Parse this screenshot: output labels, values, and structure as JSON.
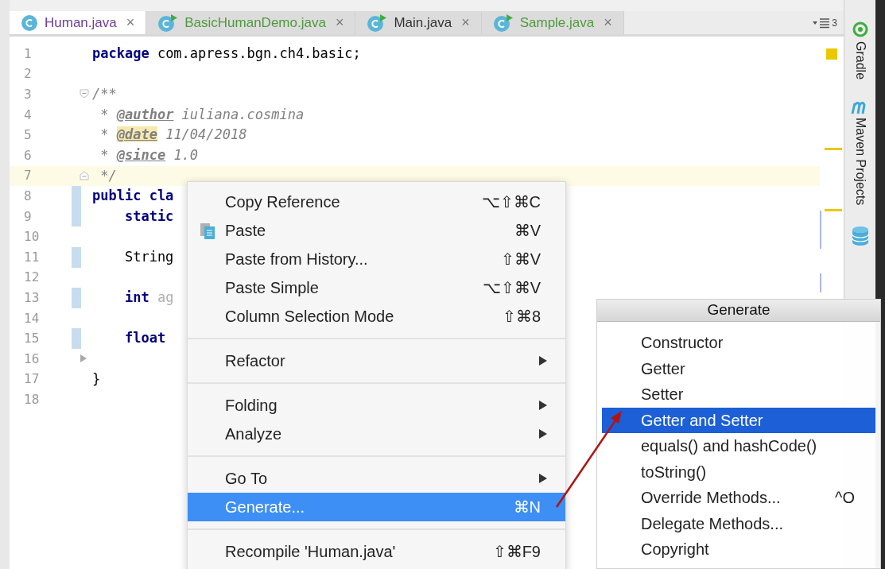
{
  "tabs": [
    {
      "label": "Human.java",
      "kind": "class",
      "color": "#6a3d9a",
      "close": "×",
      "selected": true
    },
    {
      "label": "BasicHumanDemo.java",
      "kind": "runnable",
      "color": "#4f9a3c",
      "close": "×",
      "selected": false
    },
    {
      "label": "Main.java",
      "kind": "runnable",
      "color": "#333333",
      "close": "×",
      "selected": false
    },
    {
      "label": "Sample.java",
      "kind": "runnable",
      "color": "#4f9a3c",
      "close": "×",
      "selected": false
    }
  ],
  "tab_overflow": {
    "count": "3"
  },
  "editor": {
    "lines": [
      {
        "number": "1",
        "current": false,
        "changed": false,
        "tokens": [
          {
            "kind": "keyword",
            "text": "package"
          },
          {
            "kind": "plain",
            "text": " com.apress.bgn.ch4.basic;"
          }
        ]
      },
      {
        "number": "2",
        "current": false,
        "changed": false
      },
      {
        "number": "3",
        "current": false,
        "changed": false,
        "fold": {
          "kind": "open"
        },
        "tokens": [
          {
            "kind": "comment",
            "text": "/**"
          }
        ]
      },
      {
        "number": "4",
        "current": false,
        "changed": false,
        "tokens": [
          {
            "kind": "comment",
            "text": " * "
          },
          {
            "kind": "tag",
            "text": "@author"
          },
          {
            "kind": "comment",
            "text": " iuliana.cosmina"
          }
        ]
      },
      {
        "number": "5",
        "current": false,
        "changed": false,
        "tokens": [
          {
            "kind": "comment",
            "text": " * "
          },
          {
            "kind": "tag_highlight",
            "text": "@date"
          },
          {
            "kind": "comment",
            "text": " 11/04/2018"
          }
        ]
      },
      {
        "number": "6",
        "current": false,
        "changed": false,
        "tokens": [
          {
            "kind": "comment",
            "text": " * "
          },
          {
            "kind": "tag",
            "text": "@since"
          },
          {
            "kind": "comment",
            "text": " 1.0"
          }
        ]
      },
      {
        "number": "7",
        "current": true,
        "changed": false,
        "fold": {
          "kind": "close"
        },
        "tokens": [
          {
            "kind": "comment",
            "text": " */"
          }
        ]
      },
      {
        "number": "8",
        "current": false,
        "changed": true,
        "tokens": [
          {
            "kind": "keyword",
            "text": "public cla"
          }
        ]
      },
      {
        "number": "9",
        "current": false,
        "changed": true,
        "tokens": [
          {
            "kind": "keyword",
            "text": "    static"
          }
        ]
      },
      {
        "number": "10",
        "current": false,
        "changed": false
      },
      {
        "number": "11",
        "current": false,
        "changed": true,
        "tokens": [
          {
            "kind": "plain",
            "text": "    String"
          }
        ]
      },
      {
        "number": "12",
        "current": false,
        "changed": false
      },
      {
        "number": "13",
        "current": false,
        "changed": true,
        "tokens": [
          {
            "kind": "keyword",
            "text": "    int"
          },
          {
            "kind": "faded",
            "text": " ag"
          }
        ]
      },
      {
        "number": "14",
        "current": false,
        "changed": false
      },
      {
        "number": "15",
        "current": false,
        "changed": true,
        "tokens": [
          {
            "kind": "keyword",
            "text": "    float"
          }
        ]
      },
      {
        "number": "16",
        "current": false,
        "changed": false,
        "fold": {
          "kind": "collapsed"
        }
      },
      {
        "number": "17",
        "current": false,
        "changed": false,
        "tokens": [
          {
            "kind": "plain",
            "text": "}"
          }
        ]
      },
      {
        "number": "18",
        "current": false,
        "changed": false
      }
    ]
  },
  "side_panel": [
    {
      "label": "Gradle",
      "kind": "gradle"
    },
    {
      "label": "Maven Projects",
      "kind": "maven"
    },
    {
      "kind": "database"
    }
  ],
  "context_menu": {
    "groups": [
      [
        {
          "label": "Copy Reference",
          "shortcut": "⌥⇧⌘C",
          "submenu": false,
          "selected": false
        },
        {
          "label": "Paste",
          "shortcut": "⌘V",
          "submenu": false,
          "selected": false
        },
        {
          "label": "Paste from History...",
          "shortcut": "⇧⌘V",
          "submenu": false,
          "selected": false
        },
        {
          "label": "Paste Simple",
          "shortcut": "⌥⇧⌘V",
          "submenu": false,
          "selected": false
        },
        {
          "label": "Column Selection Mode",
          "shortcut": "⇧⌘8",
          "submenu": false,
          "selected": false
        }
      ],
      [
        {
          "label": "Refactor",
          "submenu": true,
          "selected": false
        }
      ],
      [
        {
          "label": "Folding",
          "submenu": true,
          "selected": false
        },
        {
          "label": "Analyze",
          "submenu": true,
          "selected": false
        }
      ],
      [
        {
          "label": "Go To",
          "submenu": true,
          "selected": false
        },
        {
          "label": "Generate...",
          "shortcut": "⌘N",
          "submenu": false,
          "selected": true
        }
      ],
      [
        {
          "label": "Recompile 'Human.java'",
          "shortcut": "⇧⌘F9",
          "submenu": false,
          "selected": false
        }
      ]
    ]
  },
  "generate_popup": {
    "title": "Generate",
    "items": [
      {
        "label": "Constructor",
        "selected": false
      },
      {
        "label": "Getter",
        "selected": false
      },
      {
        "label": "Setter",
        "selected": false
      },
      {
        "label": "Getter and Setter",
        "selected": true
      },
      {
        "label": "equals() and hashCode()",
        "selected": false
      },
      {
        "label": "toString()",
        "selected": false
      },
      {
        "label": "Override Methods...",
        "shortcut": "^O",
        "selected": false
      },
      {
        "label": "Delegate Methods...",
        "selected": false
      },
      {
        "label": "Copyright",
        "selected": false
      }
    ]
  }
}
